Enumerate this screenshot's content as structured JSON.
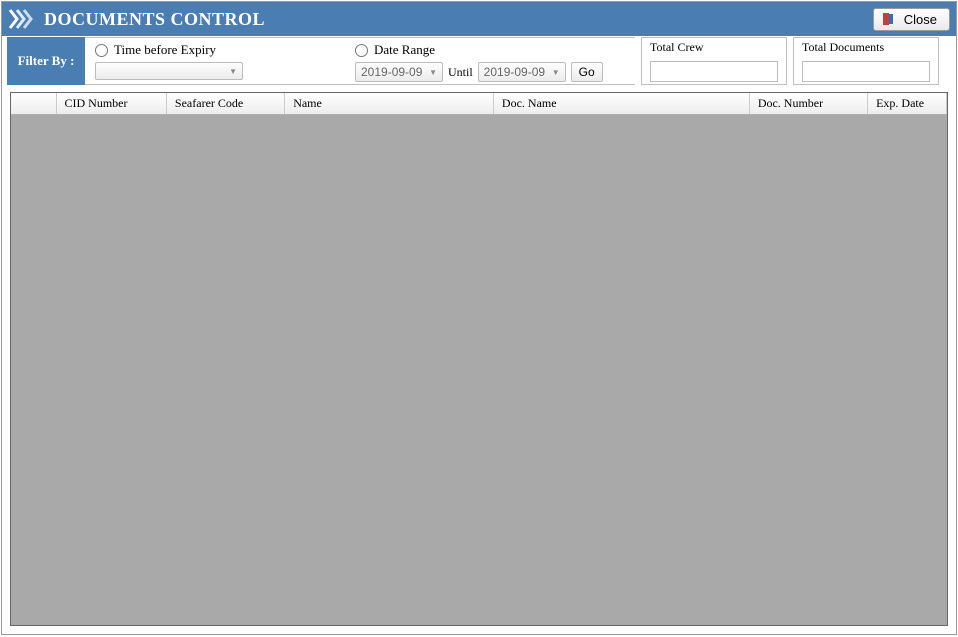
{
  "titlebar": {
    "title": "DOCUMENTS CONTROL",
    "close_label": "Close"
  },
  "filter": {
    "filterby_label": "Filter By :",
    "time_before_expiry_label": "Time before Expiry",
    "time_before_expiry_value": "",
    "date_range_label": "Date Range",
    "date_from": "2019-09-09",
    "until_label": "Until",
    "date_to": "2019-09-09",
    "go_label": "Go"
  },
  "totals": {
    "total_crew_label": "Total Crew",
    "total_crew_value": "",
    "total_documents_label": "Total Documents",
    "total_documents_value": ""
  },
  "grid": {
    "columns": {
      "status": "",
      "cid": "CID Number",
      "seafarer": "Seafarer Code",
      "name": "Name",
      "docname": "Doc. Name",
      "docnum": "Doc. Number",
      "expdate": "Exp. Date"
    },
    "rows": []
  }
}
